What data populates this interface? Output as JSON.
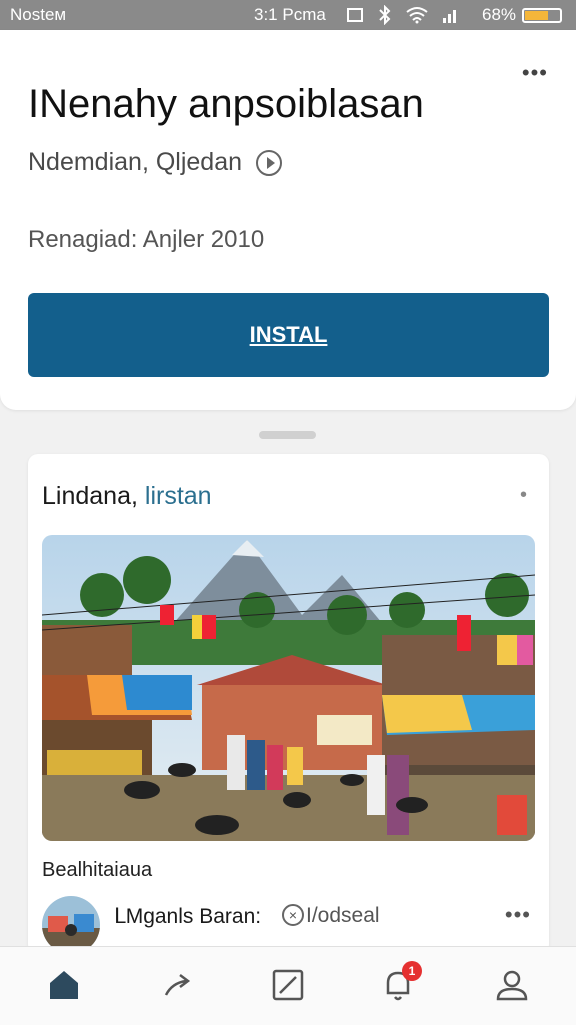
{
  "status_bar": {
    "carrier": "Nosteм",
    "time": "3:1 Pcma",
    "battery_percent": "68%",
    "battery_level": 0.68,
    "icons": [
      "sim-icon",
      "bluetooth-icon",
      "wifi-icon",
      "signal-icon",
      "battery-icon"
    ]
  },
  "app": {
    "more_label": "•••",
    "title": "INenahy anpsoiblasan",
    "location": "Ndemdian, Qljedan",
    "released": "Renagiad: Anjler 2010",
    "install_label": "INSTAL",
    "accent_color": "#135f8c"
  },
  "feed": {
    "title_main": "Lindana,",
    "title_accent": "lirstan",
    "dot_label": "•",
    "caption": "Bealhitaiaua",
    "user": {
      "name": "ᒪMganls Baran:",
      "handle": "I/odseal",
      "more_label": "•••"
    }
  },
  "nav": {
    "items": [
      "home-icon",
      "share-icon",
      "edit-icon",
      "notifications-icon",
      "profile-icon"
    ],
    "notification_badge": "1"
  }
}
